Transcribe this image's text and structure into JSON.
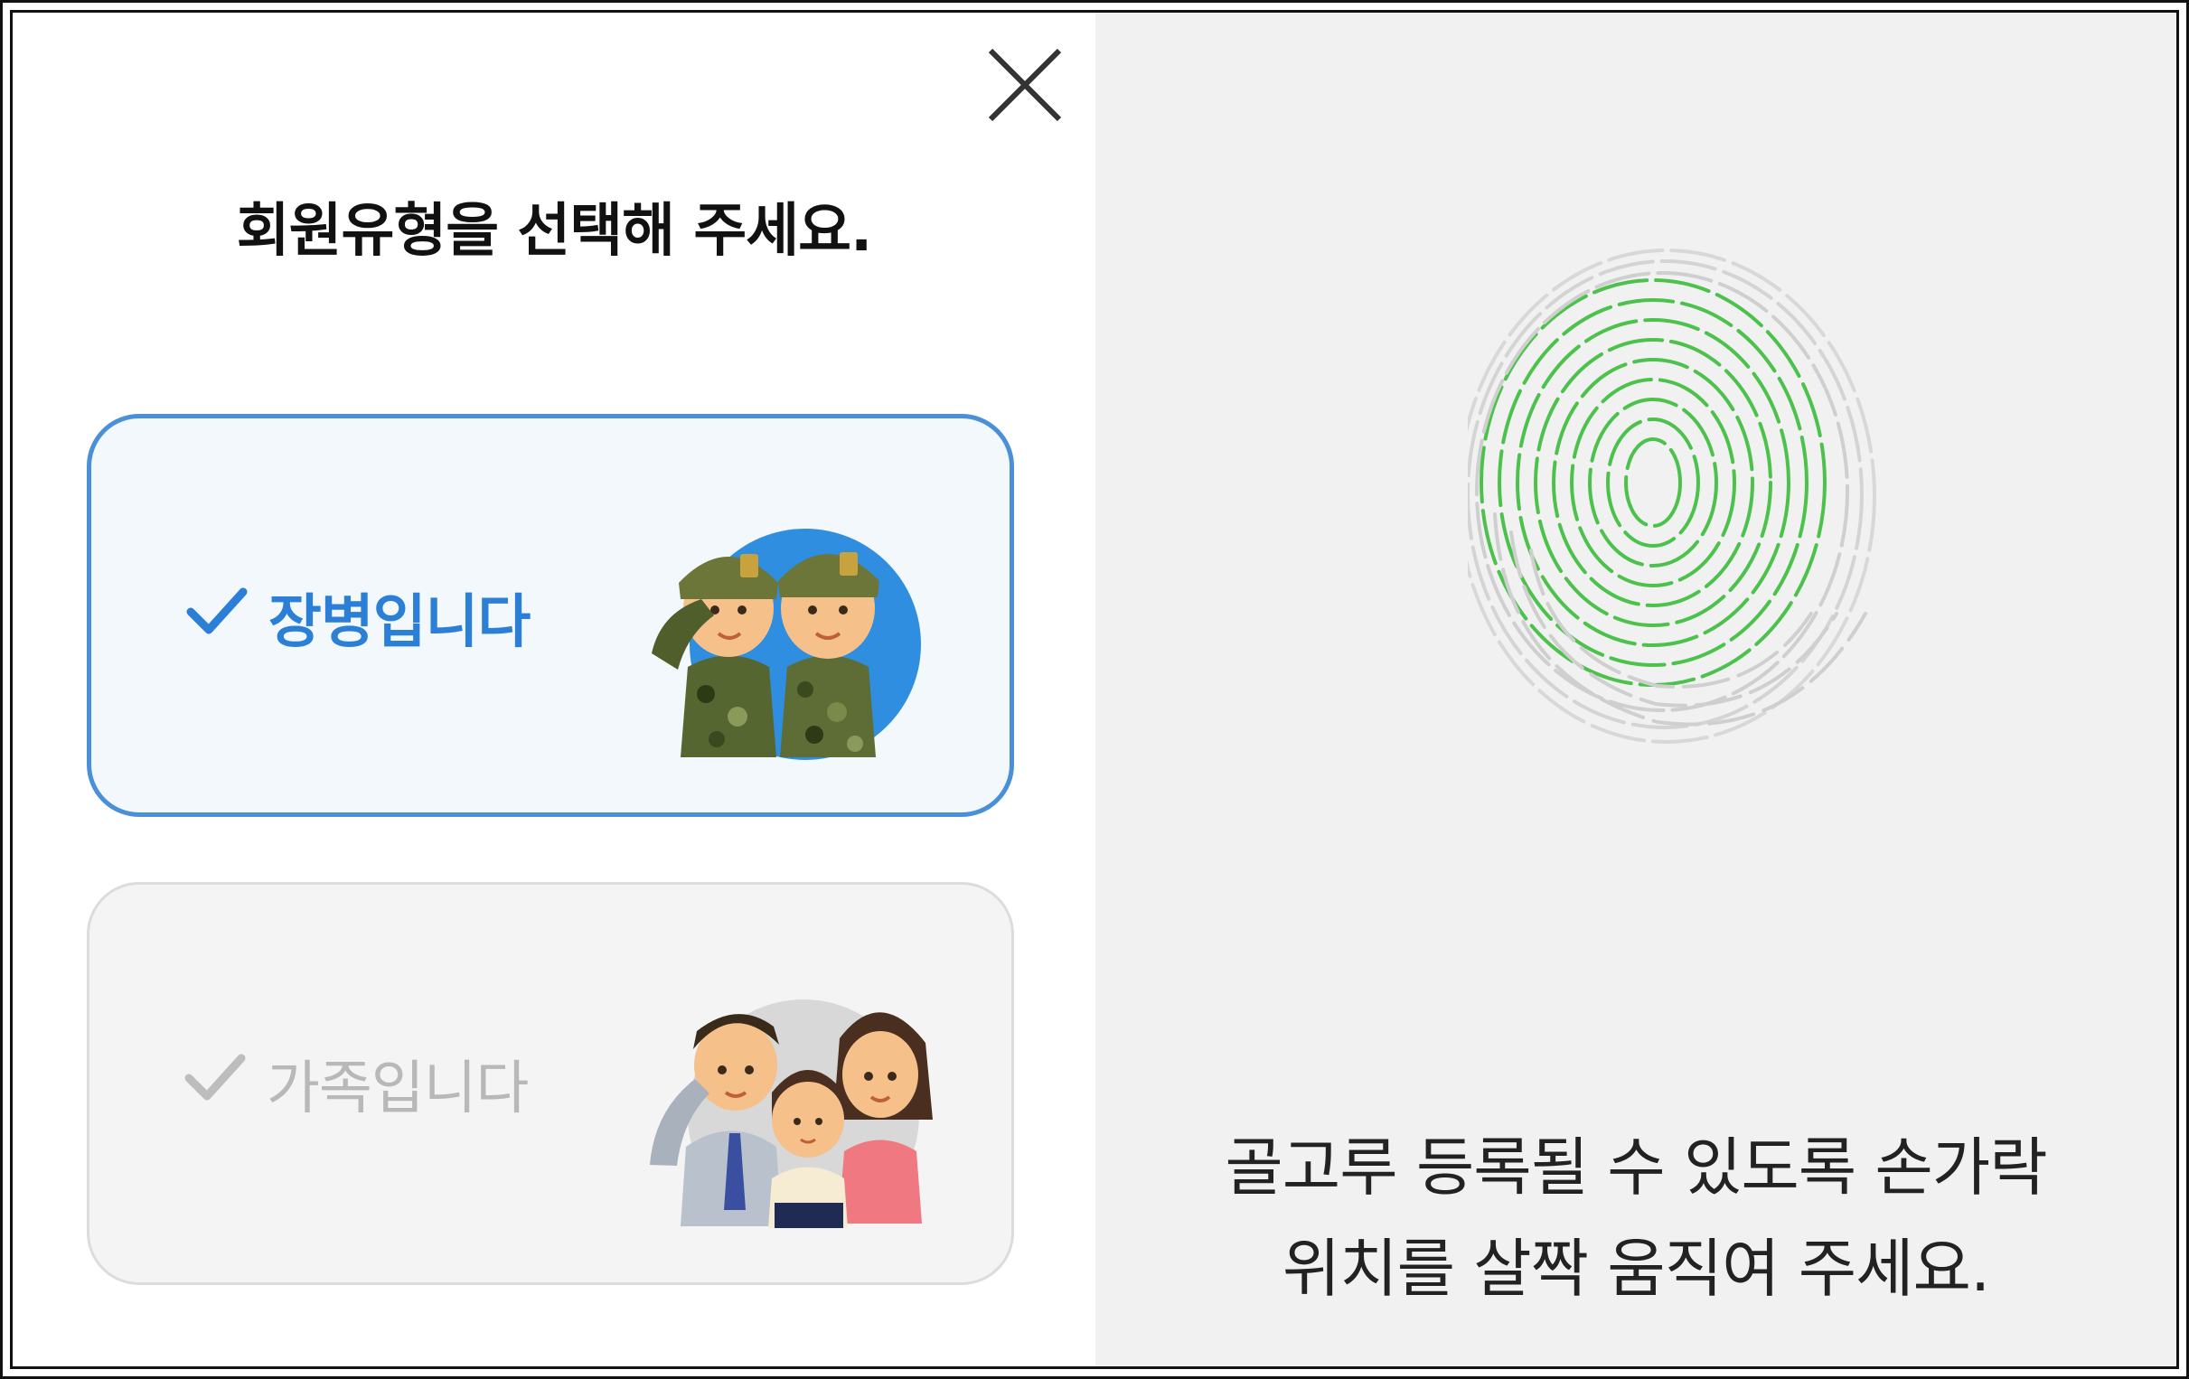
{
  "dialog": {
    "title": "회원유형을 선택해 주세요.",
    "options": [
      {
        "label": "장병입니다",
        "selected": true,
        "illustration": "two-saluting-soldiers"
      },
      {
        "label": "가족입니다",
        "selected": false,
        "illustration": "family-members"
      }
    ]
  },
  "fingerprint_panel": {
    "line1": "골고루 등록될 수 있도록 손가락",
    "line2": "위치를 살짝 움직여 주세요.",
    "progress_color": "#4cc24c"
  },
  "colors": {
    "accent": "#2b7fd6",
    "border_selected": "#4a90d9",
    "muted": "#b8b8b8"
  },
  "icons": {
    "close": "close-icon",
    "check": "check-icon",
    "fingerprint": "fingerprint-icon"
  }
}
